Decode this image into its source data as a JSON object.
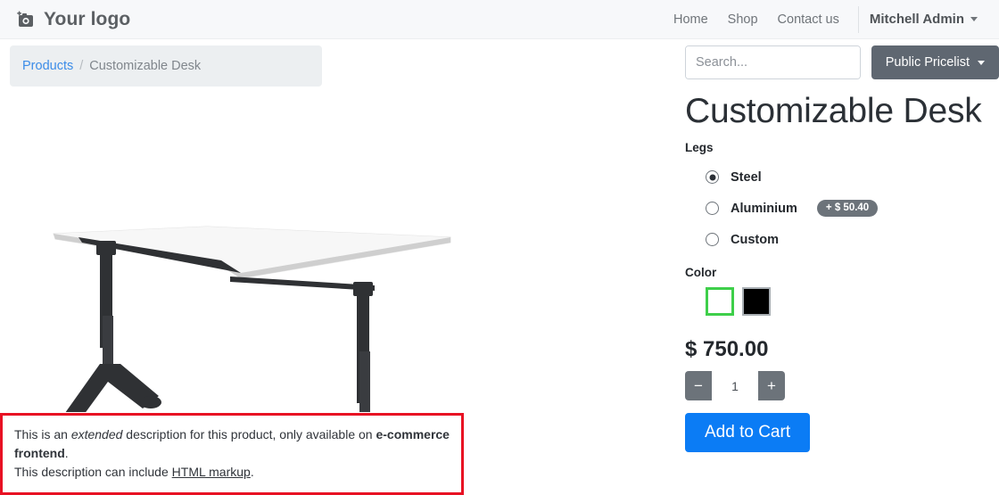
{
  "navbar": {
    "brand": "Your logo",
    "brand_icon": "camera-add-icon",
    "links": [
      {
        "label": "Home"
      },
      {
        "label": "Shop"
      },
      {
        "label": "Contact us"
      }
    ],
    "user": "Mitchell Admin",
    "user_caret_icon": "caret-down-icon"
  },
  "breadcrumb": {
    "parent": "Products",
    "separator": "/",
    "current": "Customizable Desk"
  },
  "product_image": {
    "alt": "corner-desk-white-top-black-legs",
    "top_color": "#f2f2f2",
    "leg_color": "#2f3134"
  },
  "description": {
    "line1_a": "This is an ",
    "line1_em": "extended",
    "line1_b": " description for this product, only available on ",
    "line1_strong": "e-commerce frontend",
    "line1_c": ".",
    "line2_a": "This description can include ",
    "line2_link": "HTML markup",
    "line2_b": ".",
    "border_color": "#e81123"
  },
  "search": {
    "placeholder": "Search...",
    "value": "",
    "button_icon": "search-icon",
    "button_color": "#5f6771"
  },
  "pricelist": {
    "label": "Public Pricelist",
    "caret_icon": "caret-down-icon",
    "color": "#5f6771"
  },
  "product": {
    "title": "Customizable Desk",
    "price": "$ 750.00",
    "attributes": [
      {
        "label": "Legs",
        "type": "radio",
        "options": [
          {
            "label": "Steel",
            "selected": true,
            "extra_price": ""
          },
          {
            "label": "Aluminium",
            "selected": false,
            "extra_price": "+ $ 50.40"
          },
          {
            "label": "Custom",
            "selected": false,
            "extra_price": ""
          }
        ]
      },
      {
        "label": "Color",
        "type": "swatch",
        "options": [
          {
            "name": "white",
            "hex": "#ffffff",
            "selected": true
          },
          {
            "name": "black",
            "hex": "#000000",
            "selected": false
          }
        ]
      }
    ],
    "quantity": {
      "decrement_label": "−",
      "value": "1",
      "increment_label": "+"
    },
    "add_to_cart_label": "Add to Cart",
    "add_to_cart_color": "#0b7cf5"
  }
}
